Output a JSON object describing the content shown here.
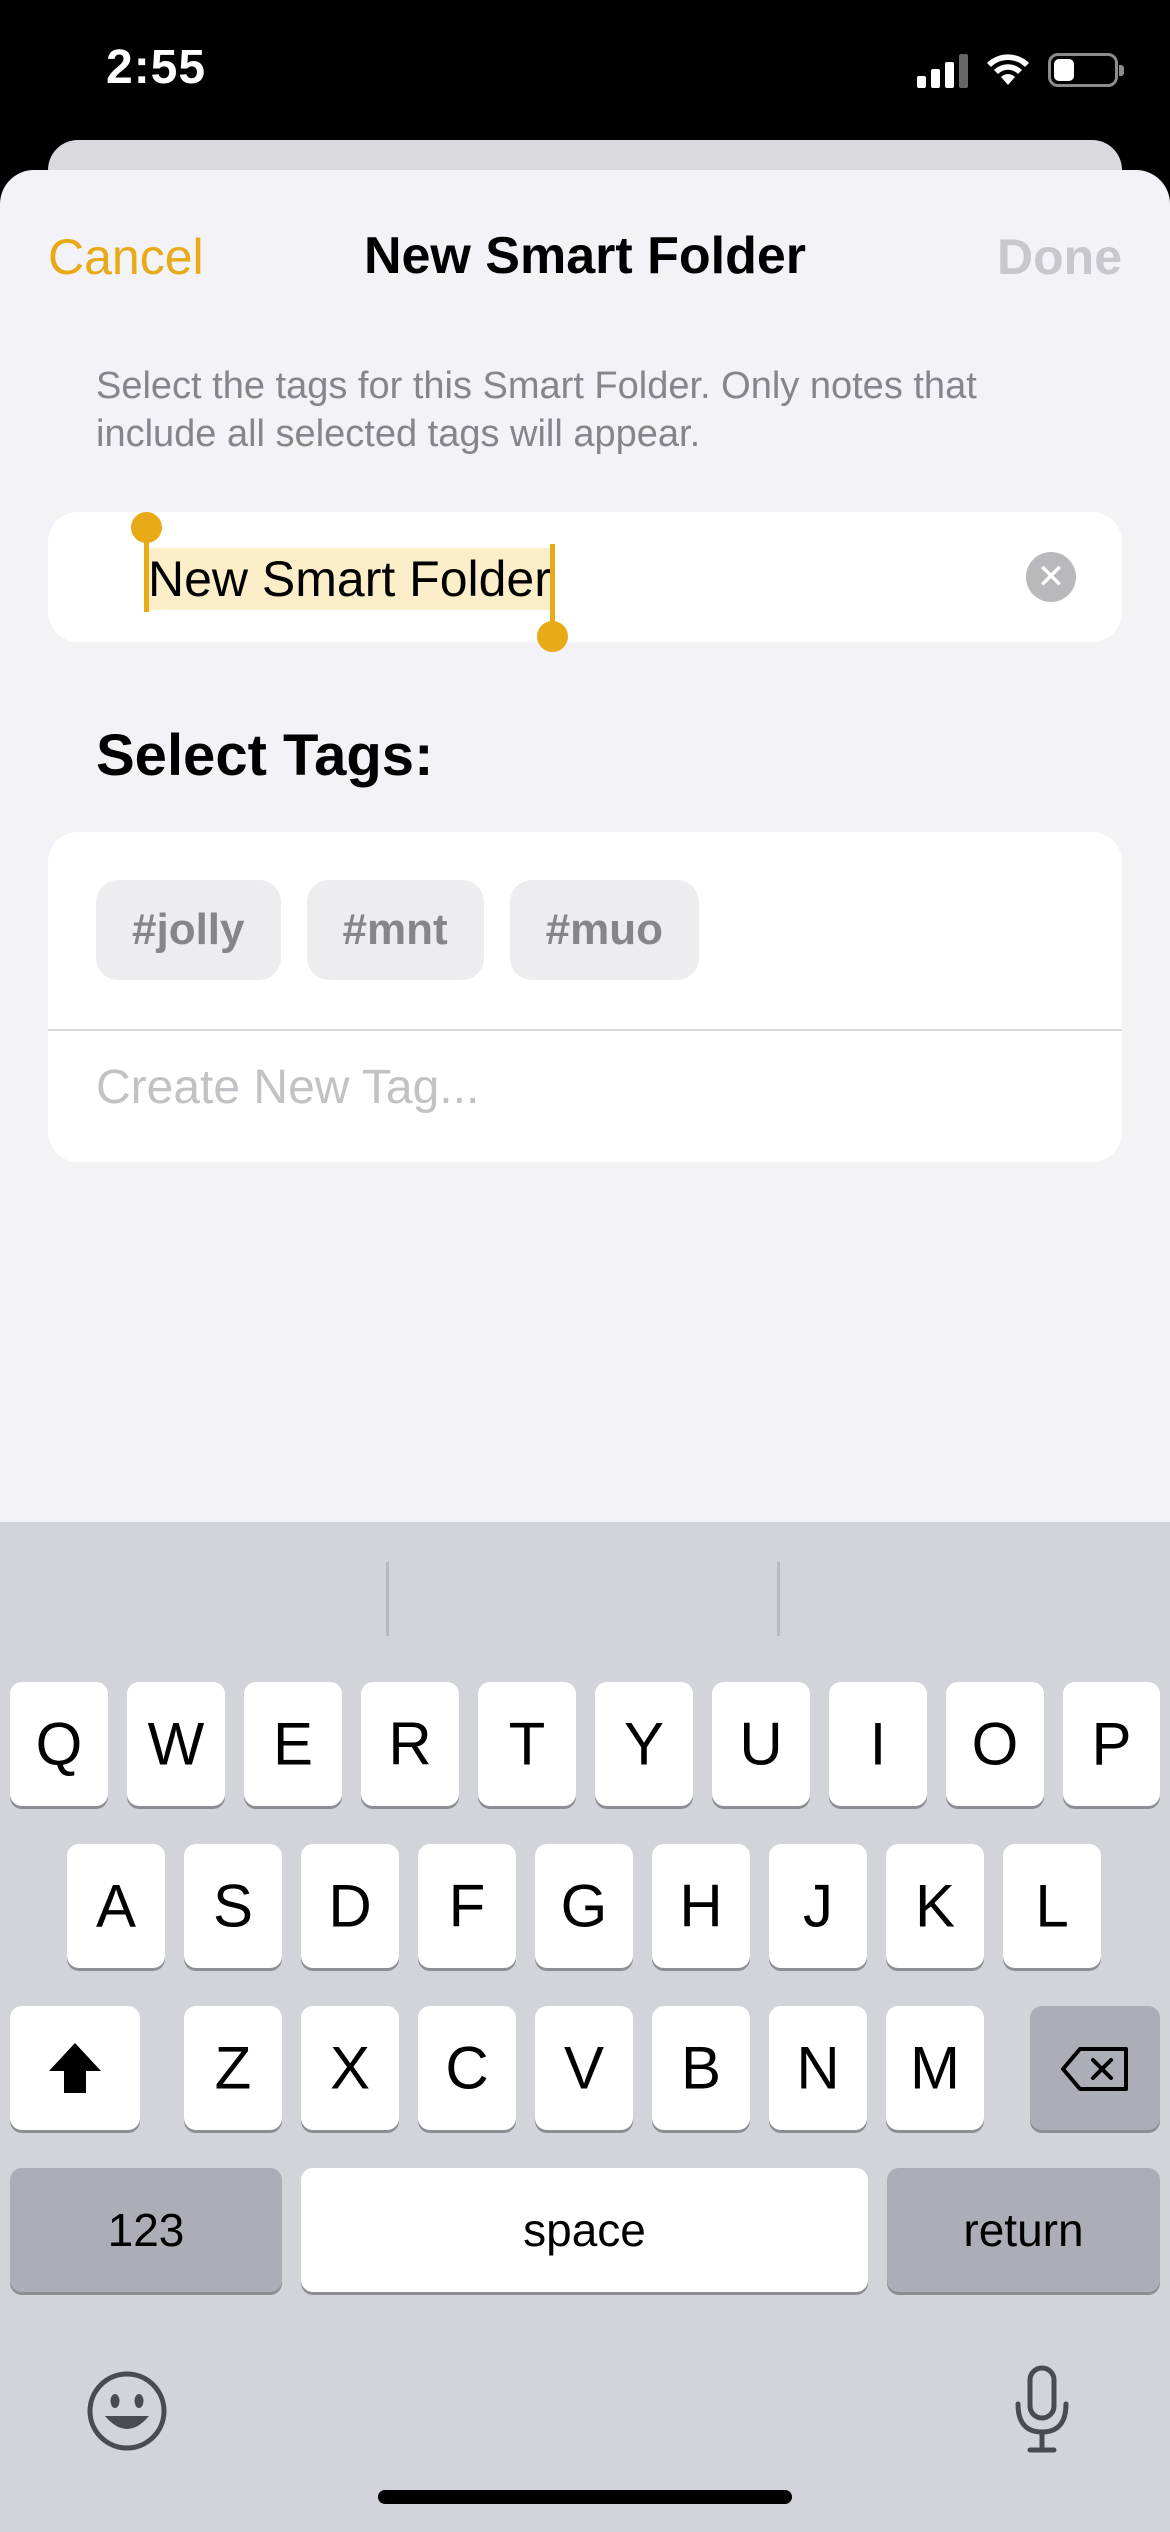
{
  "status_bar": {
    "time": "2:55"
  },
  "nav": {
    "cancel": "Cancel",
    "title": "New Smart Folder",
    "done": "Done"
  },
  "description": "Select the tags for this Smart Folder. Only notes that include all selected tags will appear.",
  "name_field": {
    "value": "New Smart Folder"
  },
  "section_title": "Select Tags:",
  "tags": [
    "#jolly",
    "#mnt",
    "#muo"
  ],
  "create_tag_placeholder": "Create New Tag...",
  "keyboard": {
    "row1": [
      "Q",
      "W",
      "E",
      "R",
      "T",
      "Y",
      "U",
      "I",
      "O",
      "P"
    ],
    "row2": [
      "A",
      "S",
      "D",
      "F",
      "G",
      "H",
      "J",
      "K",
      "L"
    ],
    "row3": [
      "Z",
      "X",
      "C",
      "V",
      "B",
      "N",
      "M"
    ],
    "numbers_key": "123",
    "space_key": "space",
    "return_key": "return"
  },
  "colors": {
    "accent": "#e8aa17",
    "background": "#f2f2f7"
  }
}
